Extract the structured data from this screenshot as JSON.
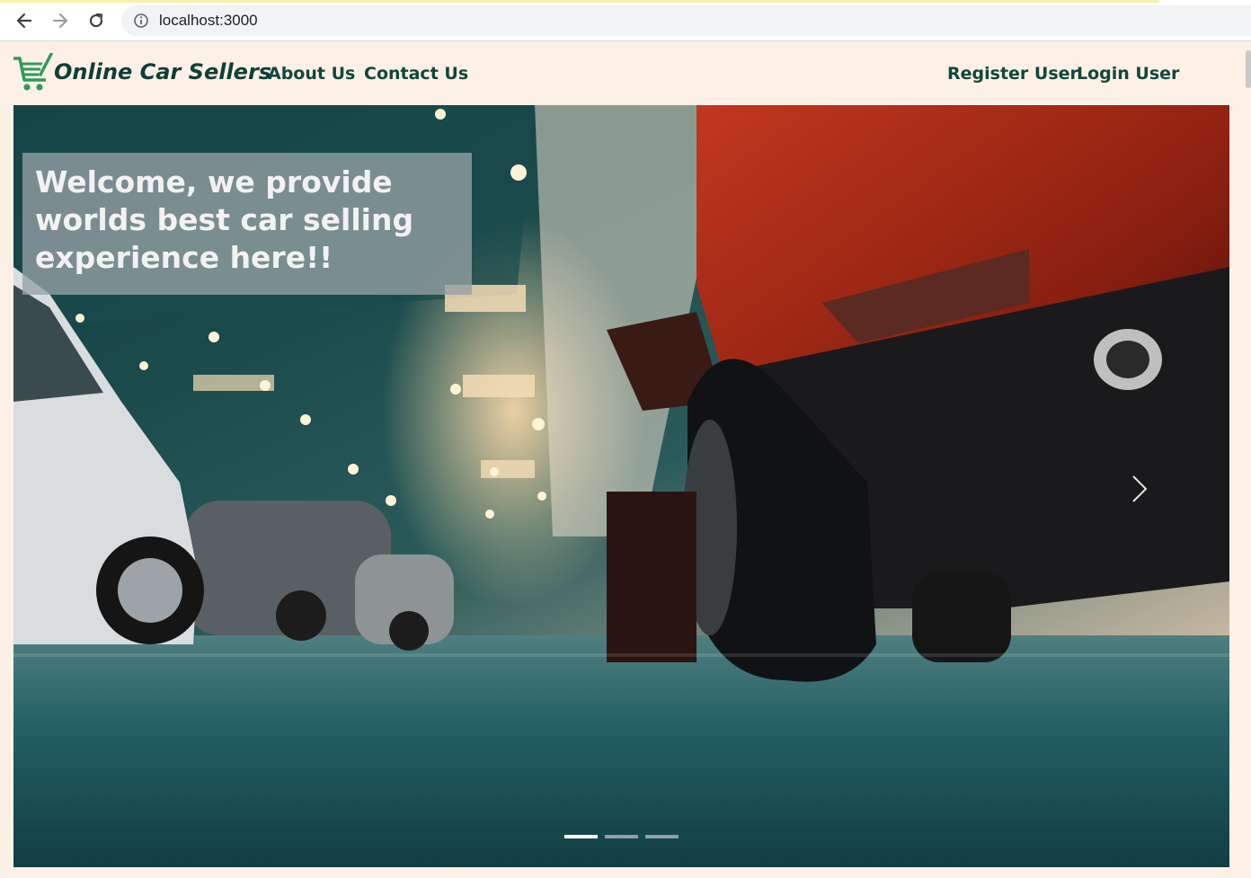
{
  "browser": {
    "url": "localhost:3000",
    "back_icon": "arrow-left-icon",
    "forward_icon": "arrow-right-icon",
    "reload_icon": "reload-icon",
    "site_info_icon": "info-icon"
  },
  "navbar": {
    "logo_icon": "shopping-cart-icon",
    "brand": "Online Car Sellers",
    "links": [
      {
        "label": "About Us"
      },
      {
        "label": "Contact Us"
      }
    ],
    "right_links": [
      {
        "label": "Register User"
      },
      {
        "label": "Login User"
      }
    ],
    "colors": {
      "background": "#fdf0e6",
      "text": "#11473b",
      "logo": "#2e9b5a"
    }
  },
  "carousel": {
    "caption": "Welcome, we provide worlds best car selling experience here!!",
    "next_icon": "chevron-right-icon",
    "slide_count": 3,
    "active_slide": 1
  }
}
